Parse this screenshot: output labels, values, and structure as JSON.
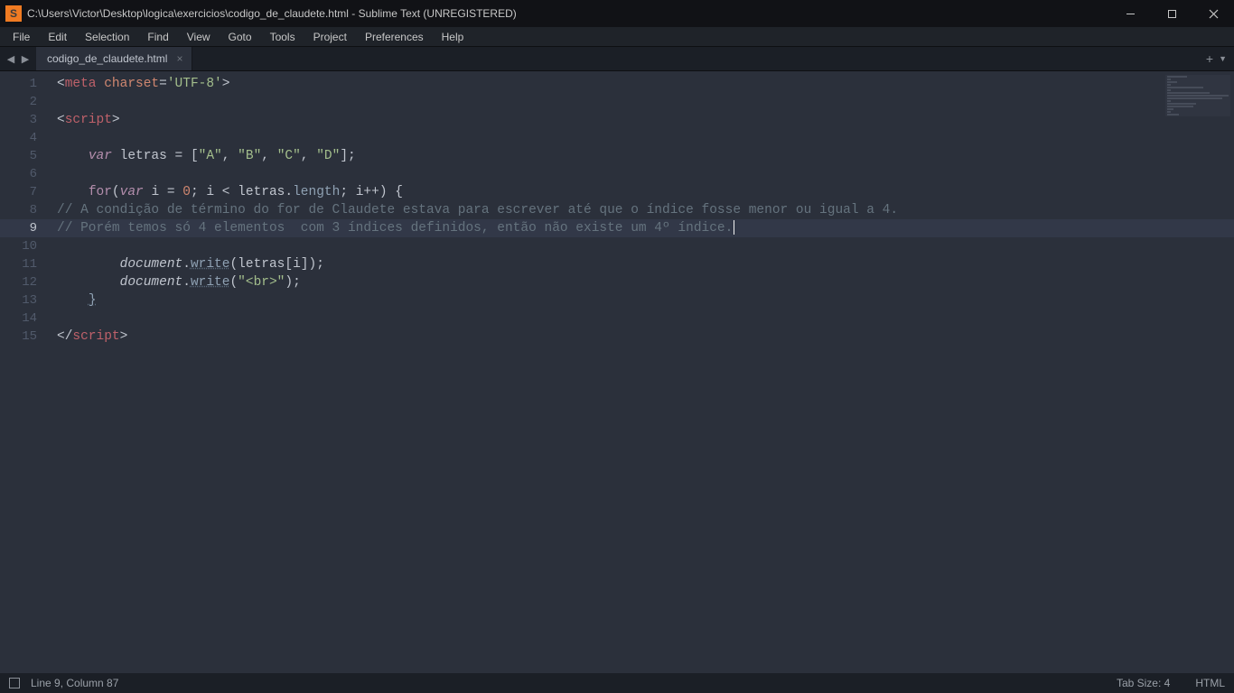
{
  "window": {
    "title": "C:\\Users\\Victor\\Desktop\\logica\\exercicios\\codigo_de_claudete.html - Sublime Text (UNREGISTERED)",
    "app_icon_letter": "S"
  },
  "menu": {
    "items": [
      "File",
      "Edit",
      "Selection",
      "Find",
      "View",
      "Goto",
      "Tools",
      "Project",
      "Preferences",
      "Help"
    ]
  },
  "tabs": {
    "active": {
      "label": "codigo_de_claudete.html"
    },
    "nav_prev": "◀",
    "nav_next": "▶",
    "close_glyph": "×",
    "add_glyph": "+",
    "dropdown_glyph": "▼"
  },
  "gutter": {
    "lines": [
      "1",
      "2",
      "3",
      "4",
      "5",
      "6",
      "7",
      "8",
      "9",
      "10",
      "11",
      "12",
      "13",
      "14",
      "15"
    ],
    "highlight_index": 8
  },
  "code": {
    "l1": {
      "a": "<",
      "b": "meta",
      "sp": " ",
      "c": "charset",
      "eq": "=",
      "d": "'UTF-8'",
      "e": ">"
    },
    "l3": {
      "a": "<",
      "b": "script",
      "c": ">"
    },
    "l5": {
      "indent": "    ",
      "kw": "var",
      "sp": " ",
      "id": "letras",
      "eq": " = ",
      "br": "[",
      "s1": "\"A\"",
      "c1": ", ",
      "s2": "\"B\"",
      "c2": ", ",
      "s3": "\"C\"",
      "c3": ", ",
      "s4": "\"D\"",
      "brc": "]",
      "semi": ";"
    },
    "l7": {
      "indent": "    ",
      "for": "for",
      "op": "(",
      "var": "var",
      "sp": " ",
      "i": "i",
      "eq": " = ",
      "z": "0",
      "sc1": "; ",
      "i2": "i",
      "lt": " < ",
      "arr": "letras",
      "dot": ".",
      "len": "length",
      "sc2": "; ",
      "i3": "i",
      "pp": "++",
      "cp": ") ",
      "ob": "{"
    },
    "l8": "// A condição de término do for de Claudete estava para escrever até que o índice fosse menor ou igual a 4.",
    "l9": "// Porém temos só 4 elementos  com 3 índices definidos, então não existe um 4º índice.",
    "l11": {
      "indent": "        ",
      "doc": "document",
      "dot": ".",
      "fn": "write",
      "op": "(",
      "arr": "letras",
      "br": "[",
      "i": "i",
      "brc": "]",
      "cp": ")",
      "semi": ";"
    },
    "l12": {
      "indent": "        ",
      "doc": "document",
      "dot": ".",
      "fn": "write",
      "op": "(",
      "str": "\"<br>\"",
      "cp": ")",
      "semi": ";"
    },
    "l13": {
      "indent": "    ",
      "cb": "}"
    },
    "l15": {
      "a": "</",
      "b": "script",
      "c": ">"
    }
  },
  "status": {
    "position": "Line 9, Column 87",
    "tab_size": "Tab Size: 4",
    "syntax": "HTML"
  }
}
